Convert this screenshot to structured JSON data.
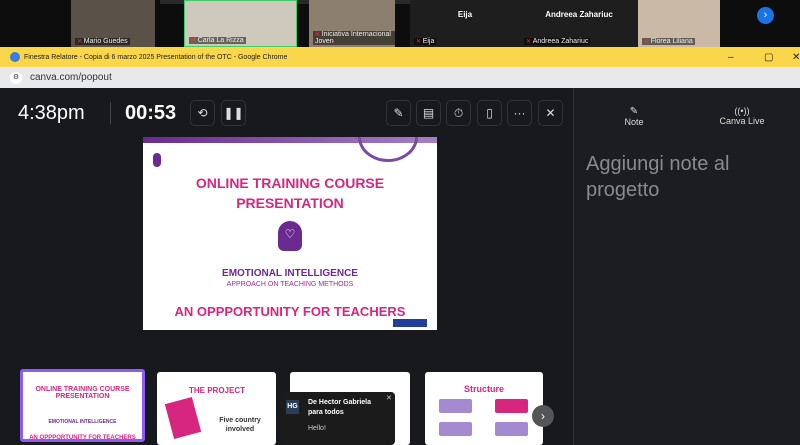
{
  "meeting": {
    "participants": [
      {
        "name": "Mario Guedes"
      },
      {
        "name": "Carla La Rizza"
      },
      {
        "name": "Iniciativa Internacional Joven"
      },
      {
        "name": "Eija"
      },
      {
        "name": "Andreea Zahariuc"
      },
      {
        "name": "Florea Liliana"
      }
    ]
  },
  "window": {
    "title": "Finestra Relatore - Copia di 6 marzo 2025 Presentation of the OTC - Google Chrome",
    "url": "canva.com/popout"
  },
  "presenter": {
    "clock": "4:38pm",
    "timer": "00:53",
    "slide": {
      "title_line1": "ONLINE TRAINING COURSE",
      "title_line2": "PRESENTATION",
      "subtitle": "EMOTIONAL INTELLIGENCE",
      "subtitle2": "APPROACH ON TEACHING METHODS",
      "tagline": "AN OPPPORTUNITY FOR TEACHERS"
    },
    "thumbnails": [
      {
        "title": "ONLINE TRAINING COURSE PRESENTATION",
        "sub": "EMOTIONAL INTELLIGENCE",
        "tag": "AN OPPPORTUNITY FOR TEACHERS"
      },
      {
        "title": "THE PROJECT",
        "sub": "Five country involved"
      },
      {
        "title": ""
      },
      {
        "title": "Structure"
      }
    ]
  },
  "notes_panel": {
    "tab_note": "Note",
    "tab_live": "Canva Live",
    "placeholder": "Aggiungi note al progetto"
  },
  "toast": {
    "initials": "HG",
    "from": "De Hector Gabriela para todos",
    "message": "Hello!"
  },
  "colors": {
    "accent": "#d6267f",
    "purple": "#6b2a8f",
    "titlebar": "#f9d64a"
  }
}
